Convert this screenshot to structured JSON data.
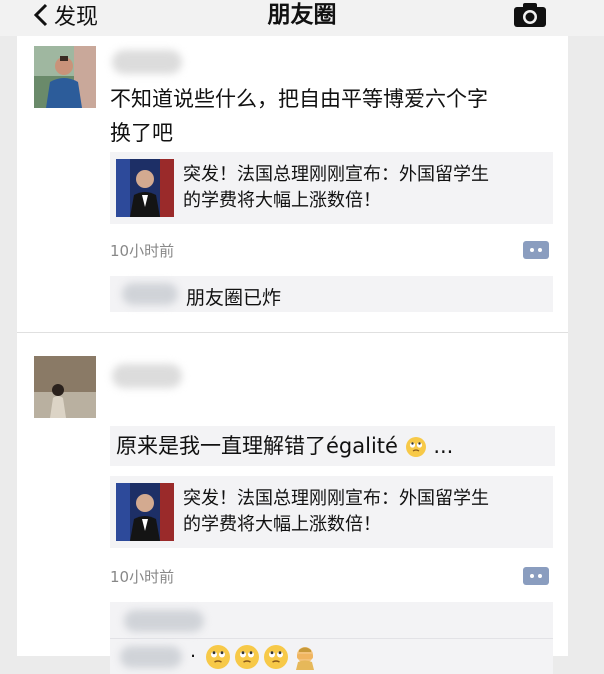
{
  "nav": {
    "back_label": "发现",
    "title": "朋友圈"
  },
  "posts": [
    {
      "text_lines": [
        "不知道说些什么，把自由平等博爱六个字",
        "换了吧"
      ],
      "share": {
        "text_lines": [
          "突发！法国总理刚刚宣布：外国留学生",
          "的学费将大幅上涨数倍！"
        ]
      },
      "time": "10小时前",
      "comment": "朋友圈已炸"
    },
    {
      "text": "原来是我一直理解错了égalité",
      "text_suffix": "...",
      "share": {
        "text_lines": [
          "突发！法国总理刚刚宣布：外国留学生",
          "的学费将大幅上涨数倍！"
        ]
      },
      "time": "10小时前",
      "comment_dot": "."
    }
  ],
  "colors": {
    "accent": "#8a9dbf",
    "time": "#888888",
    "comment_bg": "#f3f3f5"
  },
  "icons": [
    "chevron-left-icon",
    "camera-icon",
    "comment-icon",
    "eye-roll-emoji-icon",
    "facepalm-emoji-icon"
  ]
}
